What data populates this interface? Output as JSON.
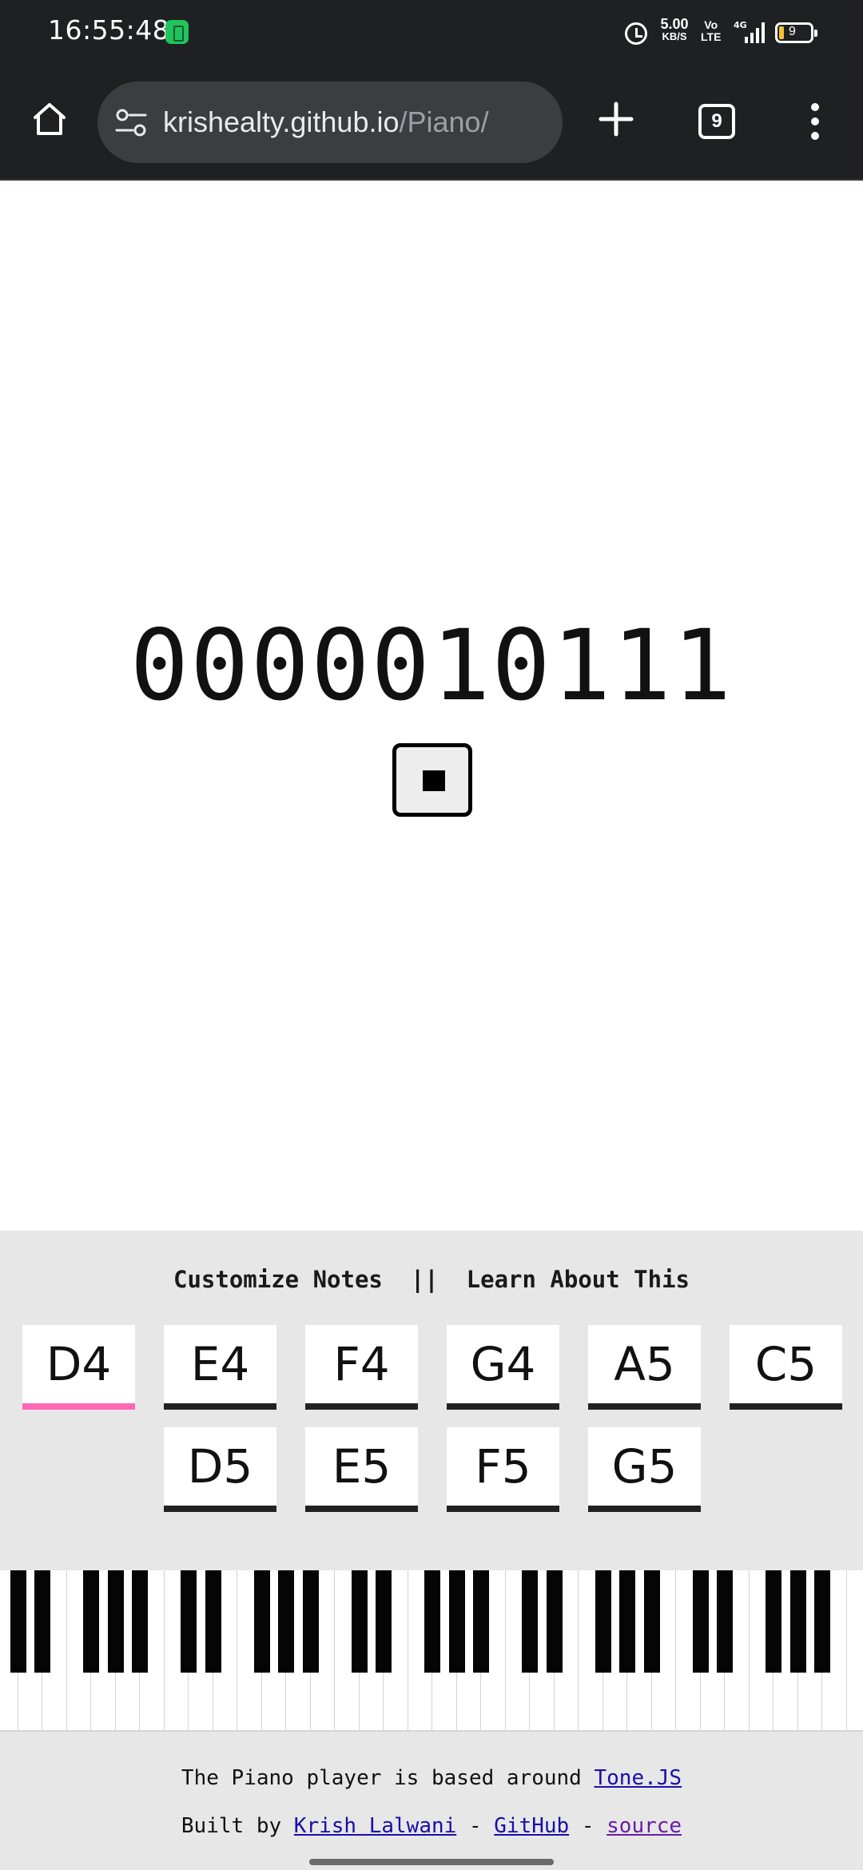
{
  "status_bar": {
    "time": "16:55:48",
    "net_speed_value": "5.00",
    "net_speed_unit": "KB/S",
    "volte_top": "Vo",
    "volte_bottom": "LTE",
    "network": "4G",
    "battery_level": "9",
    "icons": [
      "battery-saver-icon",
      "alarm-icon",
      "signal-icon",
      "battery-icon"
    ]
  },
  "browser": {
    "url_host": "krishealty.github.io",
    "url_path": "/Piano/",
    "tab_count": "9",
    "icons": [
      "home-icon",
      "site-settings-icon",
      "new-tab-icon",
      "menu-icon"
    ]
  },
  "main": {
    "binary_value": "0000010111",
    "stop_button_icon": "stop-icon"
  },
  "panel": {
    "customize_label": "Customize Notes",
    "separator": "||",
    "learn_label": "Learn About This",
    "notes": [
      "D4",
      "E4",
      "F4",
      "G4",
      "A5",
      "C5",
      "D5",
      "E5",
      "F5",
      "G5"
    ],
    "active_note": "D4"
  },
  "footer": {
    "line1_prefix": "The Piano player is based around",
    "tone_link": "Tone.JS",
    "line2_prefix": "Built by",
    "author_link": "Krish Lalwani",
    "dash1": "-",
    "github_link": "GitHub",
    "dash2": "-",
    "source_link": "source"
  },
  "colors": {
    "chrome_bg": "#1f2021",
    "panel_bg": "#e7e7e7",
    "active_note_accent": "#ff69b4",
    "link": "#1a0dab",
    "visited_link": "#681da8"
  }
}
